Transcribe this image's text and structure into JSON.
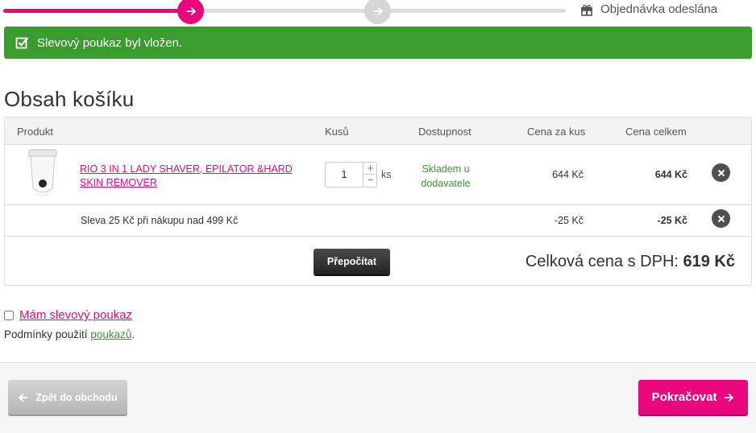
{
  "steps": {
    "final_label": "Objednávka odeslána"
  },
  "alert": {
    "message": "Slevový poukaz byl vložen."
  },
  "page_title": "Obsah košíku",
  "cart": {
    "headers": {
      "product": "Produkt",
      "quantity": "Kusů",
      "availability": "Dostupnost",
      "unit_price": "Cena za kus",
      "total_price": "Cena celkem"
    },
    "items": [
      {
        "name": "RIO 3 IN 1 LADY SHAVER, EPILATOR &HARD SKIN REMOVER",
        "quantity": "1",
        "unit": "ks",
        "availability": "Skladem u dodavatele",
        "unit_price": "644 Kč",
        "total_price": "644 Kč"
      }
    ],
    "discount": {
      "label": "Sleva 25 Kč při nákupu nad 499 Kč",
      "unit_price": "-25 Kč",
      "total_price": "-25 Kč"
    },
    "recalculate_label": "Přepočítat",
    "total_label": "Celková cena s DPH:",
    "total_value": "619 Kč"
  },
  "voucher": {
    "checkbox_label": "Mám slevový poukaz",
    "checked": false,
    "terms_prefix": "Podmínky použití ",
    "terms_link": "poukazů",
    "terms_suffix": "."
  },
  "footer": {
    "back_label": "Zpět do obchodu",
    "next_label": "Pokračovat"
  },
  "colors": {
    "accent": "#e8087e",
    "success": "#3a9b2f",
    "dark_button": "#2b2b2b",
    "grey_button": "#c4c4c4"
  }
}
